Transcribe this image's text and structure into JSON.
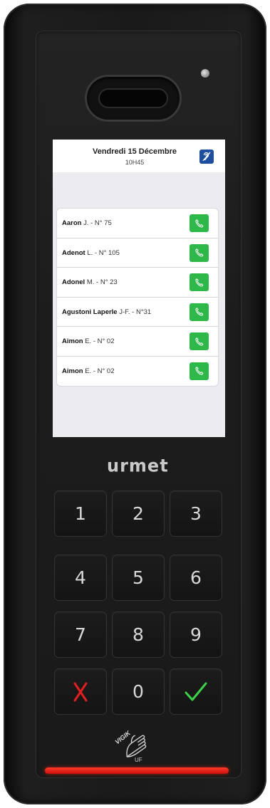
{
  "screen": {
    "date": "Vendredi 15 Décembre",
    "time": "10H45"
  },
  "directory": [
    {
      "surname": "Aaron",
      "detail": "J. - N° 75"
    },
    {
      "surname": "Adenot",
      "detail": "L. - N° 105"
    },
    {
      "surname": "Adonel",
      "detail": "M. - N° 23"
    },
    {
      "surname": "Agustoni Laperle",
      "detail": "J-F. - N°31"
    },
    {
      "surname": "Aimon",
      "detail": "E. - N° 02"
    },
    {
      "surname": "Aimon",
      "detail": "E. - N° 02"
    }
  ],
  "brand": "urmet",
  "keypad": {
    "k1": "1",
    "k2": "2",
    "k3": "3",
    "k4": "4",
    "k5": "5",
    "k6": "6",
    "k7": "7",
    "k8": "8",
    "k9": "9",
    "k0": "0"
  },
  "vigik": {
    "logo_text": "VIGIK",
    "sub_text": "UF"
  },
  "icons": {
    "accessibility": "ear-accessibility-icon",
    "call": "phone-icon",
    "cancel": "red-x-icon",
    "confirm": "green-check-icon"
  },
  "colors": {
    "call_green": "#2fb84a",
    "accessibility_blue": "#1d4f9e",
    "cancel_red": "#e02020",
    "confirm_green": "#3ed14a",
    "status_bar_red": "#e8190f"
  }
}
